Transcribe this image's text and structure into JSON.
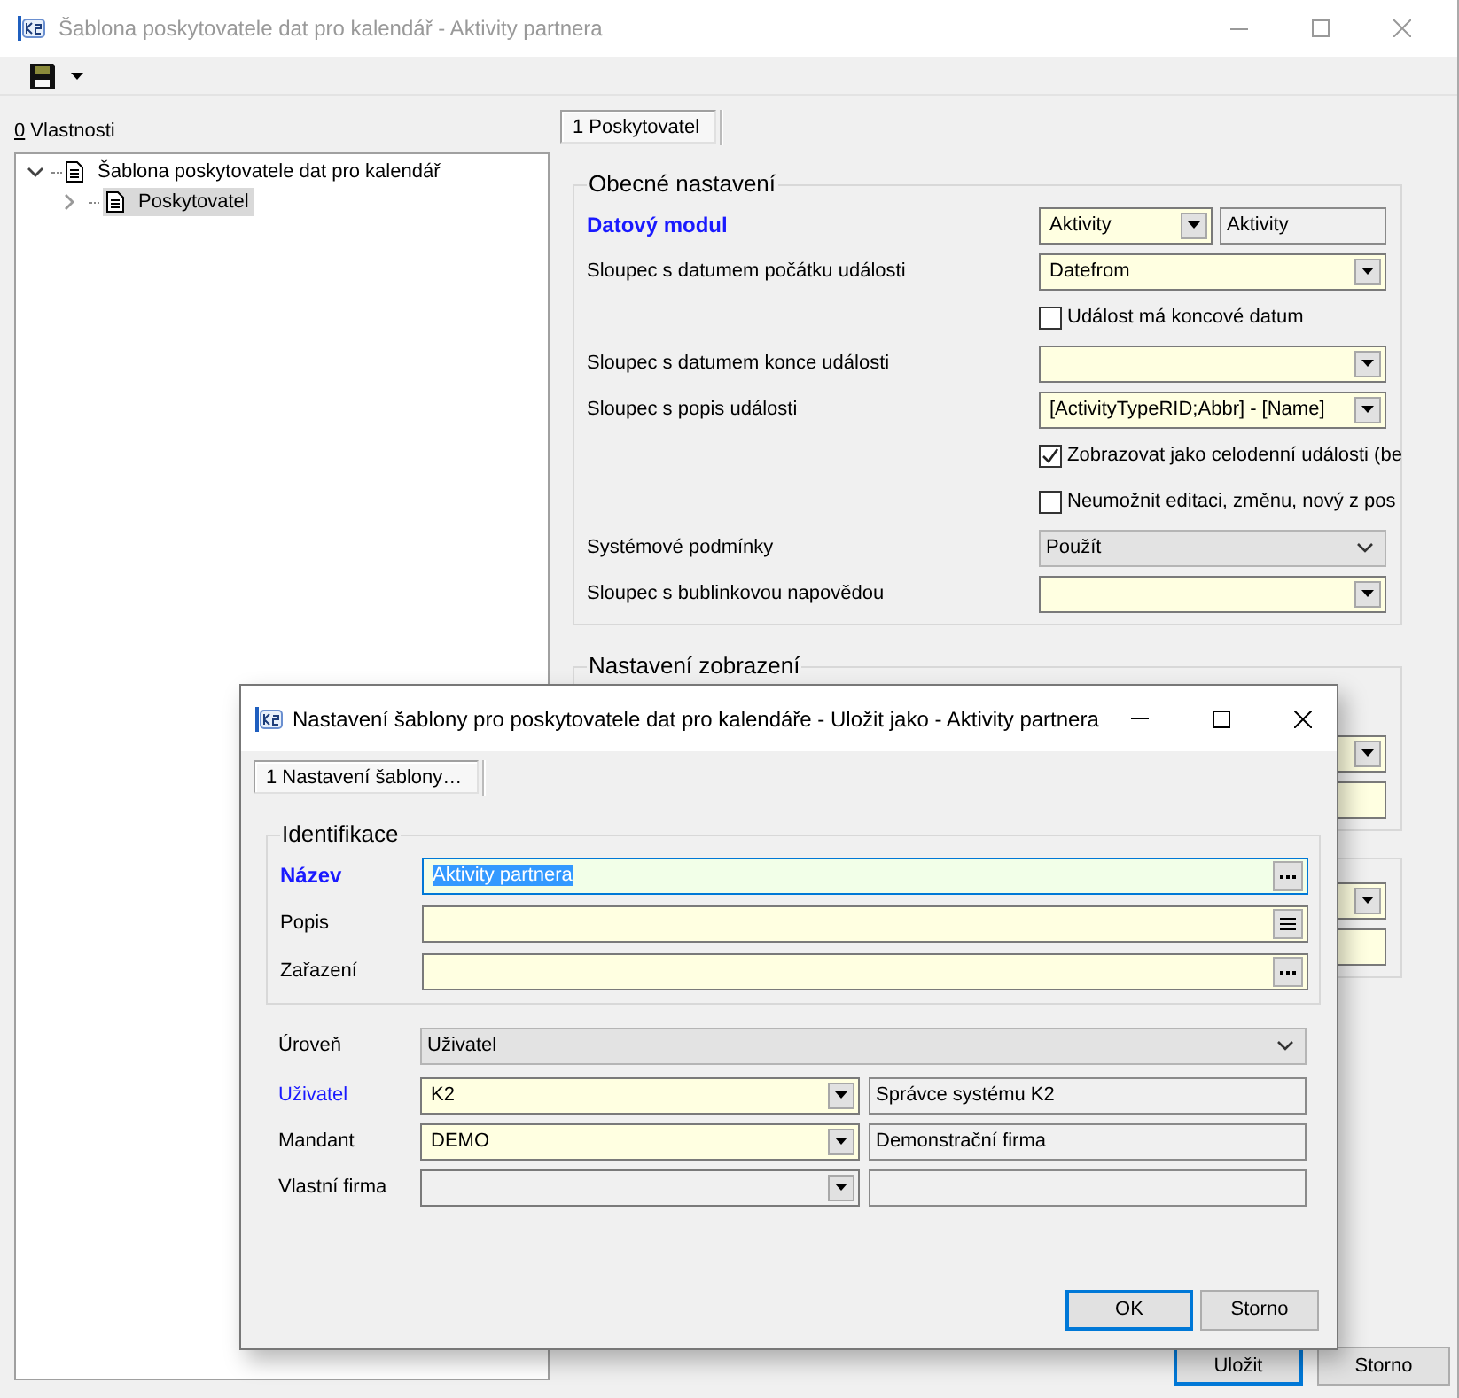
{
  "window": {
    "title": "Šablona poskytovatele dat pro kalendář - Aktivity partnera",
    "active": false
  },
  "properties": {
    "mnemonic": "0",
    "label": "Vlastnosti"
  },
  "tree": [
    {
      "label": "Šablona poskytovatele dat pro kalendář",
      "expanded": true,
      "selected": false,
      "children": [
        {
          "label": "Poskytovatel",
          "expanded": false,
          "selected": true
        }
      ]
    }
  ],
  "tabs": [
    {
      "label": "1 Poskytovatel",
      "selected": true
    }
  ],
  "groups": [
    {
      "title": "Obecné nastavení",
      "rows": [
        {
          "kind": "combo_pair",
          "label": "Datový modul",
          "required": true,
          "highlighted": true,
          "value": "Aktivity",
          "detail": "Aktivity"
        },
        {
          "kind": "combo",
          "label": "Sloupec s datumem počátku události",
          "required": false,
          "highlighted": false,
          "value": "Datefrom"
        },
        {
          "kind": "checkbox",
          "text": "Událost má koncové datum",
          "checked": false
        },
        {
          "kind": "combo",
          "label": "Sloupec s datumem konce události",
          "required": false,
          "highlighted": false
        },
        {
          "kind": "combo",
          "label": "Sloupec s popis události",
          "required": false,
          "highlighted": false,
          "value": "[ActivityTypeRID;Abbr] - [Name]"
        },
        {
          "kind": "checkbox",
          "text": "Zobrazovat jako celodenní události (be",
          "checked": true
        },
        {
          "kind": "checkbox",
          "text": "Neumožnit editaci, změnu, nový z pos",
          "checked": false
        },
        {
          "kind": "select",
          "label": "Systémové podmínky",
          "required": false,
          "highlighted": false,
          "value": "Použít"
        },
        {
          "kind": "combo",
          "label": "Sloupec s bublinkovou napovědou",
          "required": false,
          "highlighted": false
        }
      ]
    },
    {
      "title": "Nastavení zobrazení",
      "rows": [
        {
          "kind": "combo"
        },
        {
          "kind": "field"
        }
      ]
    },
    {
      "rows": [
        {
          "kind": "combo"
        },
        {
          "kind": "field"
        }
      ]
    }
  ],
  "buttons": [
    {
      "label": "Uložit",
      "default": true
    },
    {
      "label": "Storno",
      "default": false
    }
  ],
  "dialog": {
    "title": "Nastavení šablony pro poskytovatele dat pro kalendáře - Uložit jako - Aktivity partnera",
    "active": true,
    "tabs": [
      {
        "label": "1 Nastavení šablony…",
        "selected": true
      }
    ],
    "group": {
      "title": "Identifikace",
      "rows": [
        {
          "kind": "ellipsis",
          "label": "Název",
          "required": true,
          "highlighted": true,
          "value": "Aktivity partnera",
          "focused": true
        },
        {
          "kind": "memo",
          "label": "Popis",
          "required": false,
          "highlighted": false,
          "focused": false
        },
        {
          "kind": "ellipsis",
          "label": "Zařazení",
          "required": false,
          "highlighted": false,
          "focused": false
        }
      ]
    },
    "rows": [
      {
        "kind": "select",
        "label": "Úroveň",
        "required": false,
        "highlighted": false,
        "value": "Uživatel"
      },
      {
        "kind": "combo_pair",
        "label": "Uživatel",
        "required": false,
        "highlighted": true,
        "value": "K2",
        "detail": "Správce systému K2",
        "disabled": false
      },
      {
        "kind": "combo_pair",
        "label": "Mandant",
        "required": false,
        "highlighted": false,
        "value": "DEMO",
        "detail": "Demonstrační firma",
        "disabled": false
      },
      {
        "kind": "combo_pair",
        "label": "Vlastní firma",
        "required": false,
        "highlighted": false,
        "disabled": true
      }
    ],
    "buttons": [
      {
        "label": "OK",
        "default": true
      },
      {
        "label": "Storno",
        "default": false
      }
    ]
  }
}
